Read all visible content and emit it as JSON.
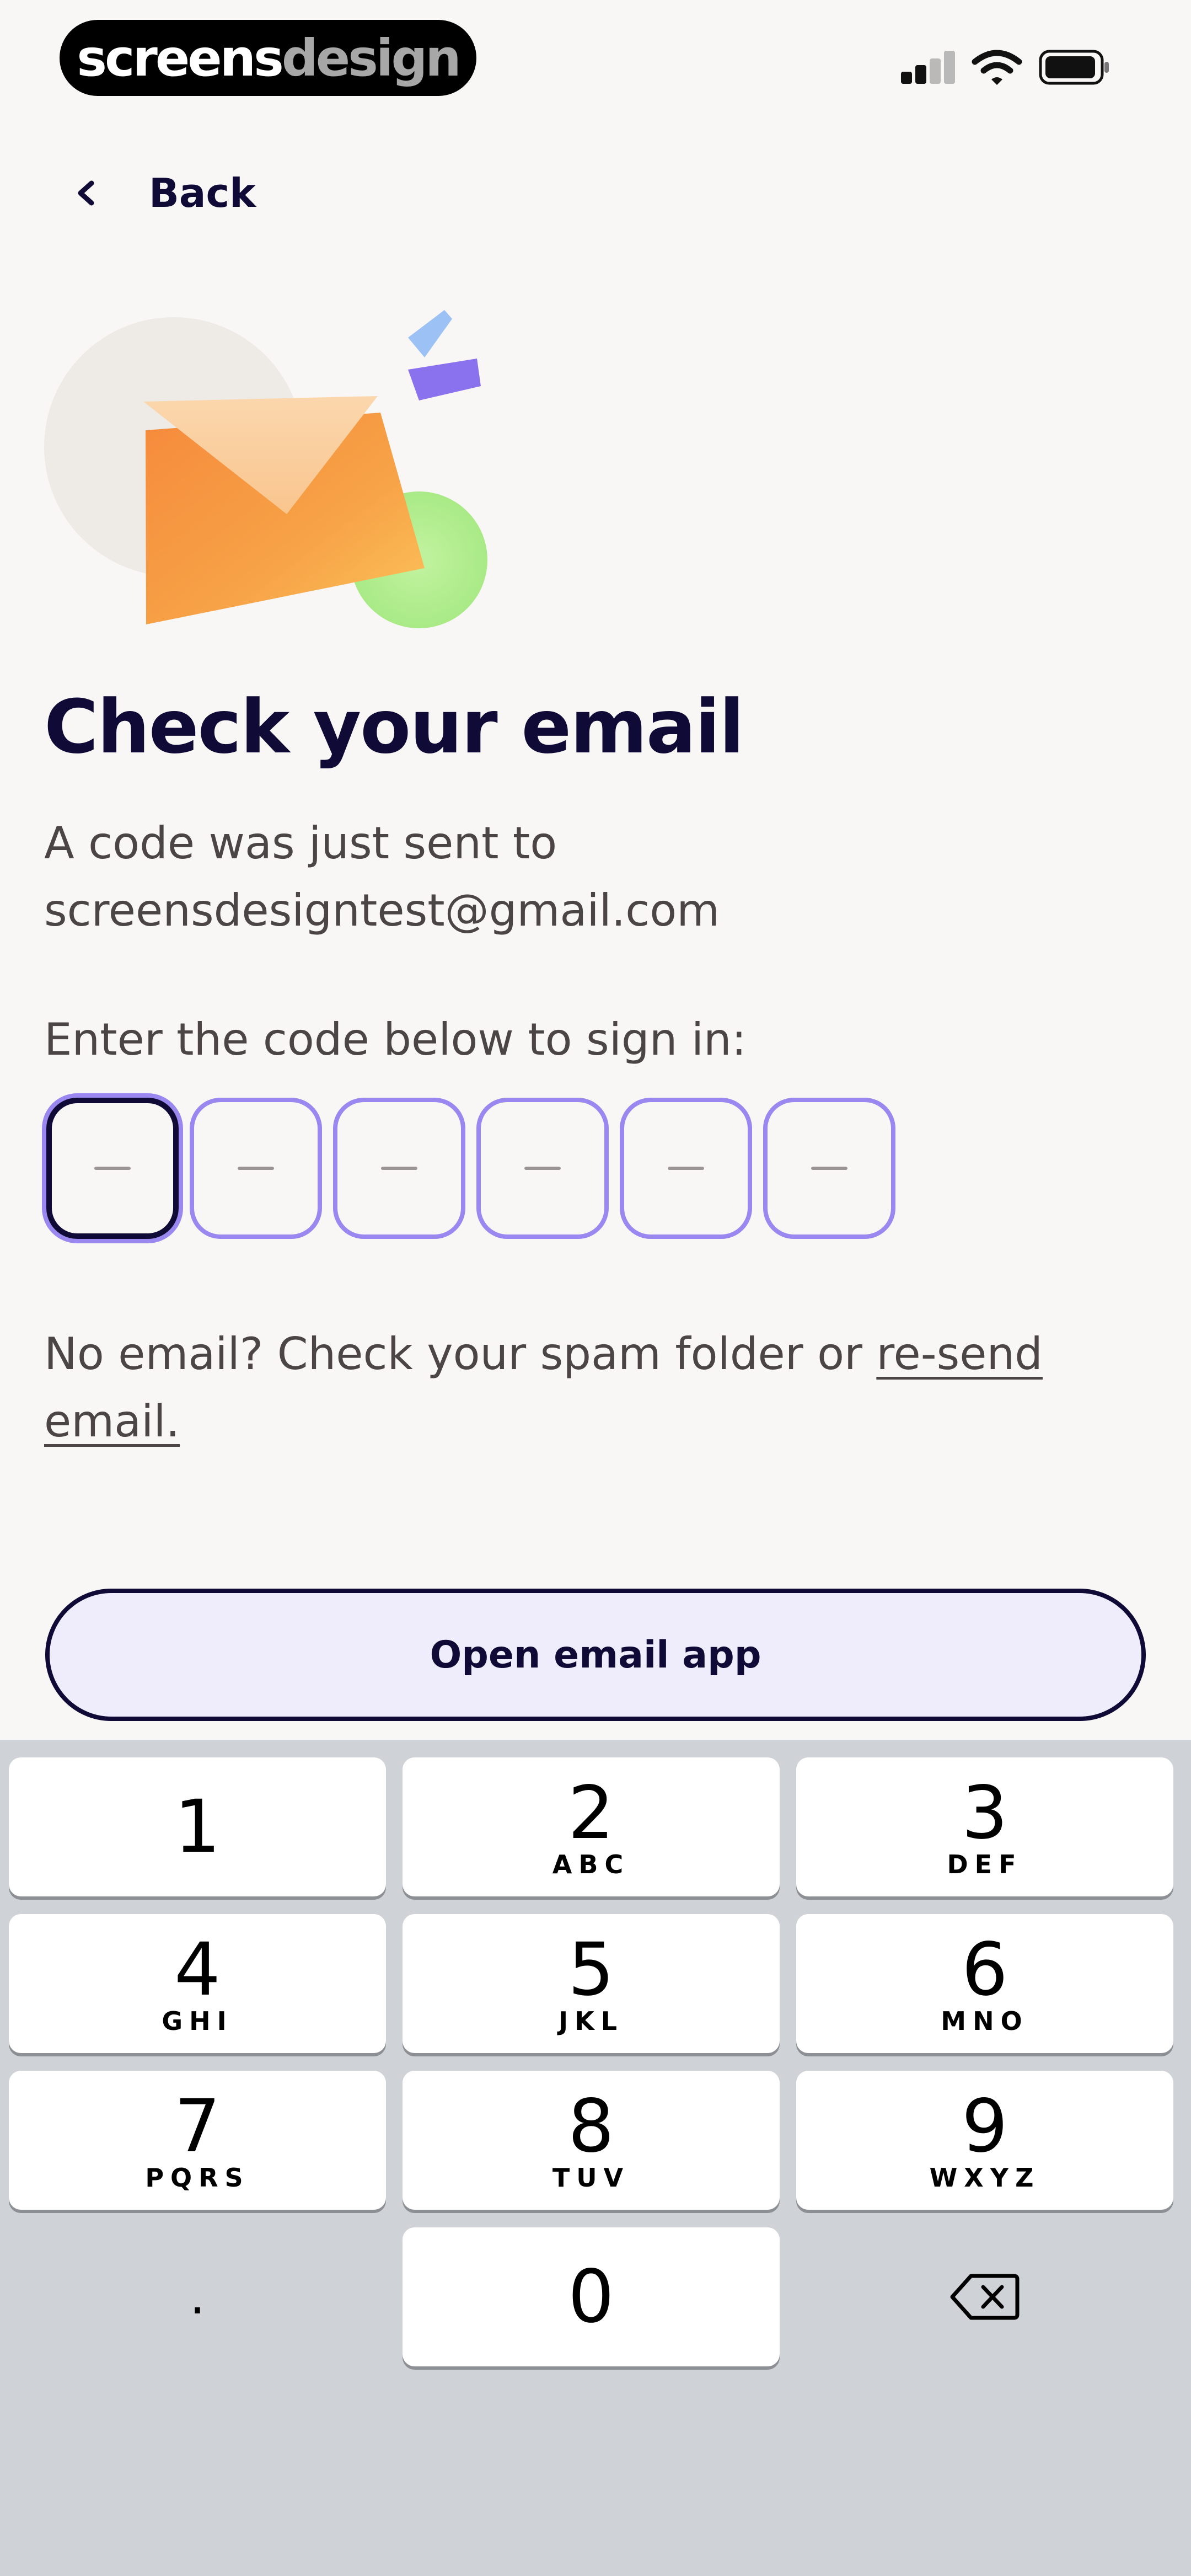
{
  "status_bar": {
    "brand_part1": "screens",
    "brand_part2": "design"
  },
  "nav": {
    "back_label": "Back"
  },
  "content": {
    "title": "Check your email",
    "subtitle_line1": "A code was just sent to",
    "email": "screensdesigntest@gmail.com",
    "enter_label": "Enter the code below to sign in:",
    "code_boxes": [
      "",
      "",
      "",
      "",
      "",
      ""
    ],
    "spam_text": "No email? Check your spam folder or ",
    "resend_link": "re-send email."
  },
  "actions": {
    "open_email_label": "Open email app"
  },
  "keypad": {
    "keys": [
      {
        "num": "1",
        "letters": ""
      },
      {
        "num": "2",
        "letters": "ABC"
      },
      {
        "num": "3",
        "letters": "DEF"
      },
      {
        "num": "4",
        "letters": "GHI"
      },
      {
        "num": "5",
        "letters": "JKL"
      },
      {
        "num": "6",
        "letters": "MNO"
      },
      {
        "num": "7",
        "letters": "PQRS"
      },
      {
        "num": "8",
        "letters": "TUV"
      },
      {
        "num": "9",
        "letters": "WXYZ"
      },
      {
        "num": ".",
        "letters": ""
      },
      {
        "num": "0",
        "letters": ""
      }
    ]
  },
  "colors": {
    "background": "#f9f7f6",
    "ink": "#0f0a36",
    "accent_purple": "#9a88f0",
    "button_fill": "#efecfc",
    "keyboard_bg": "#cfd2d7"
  }
}
